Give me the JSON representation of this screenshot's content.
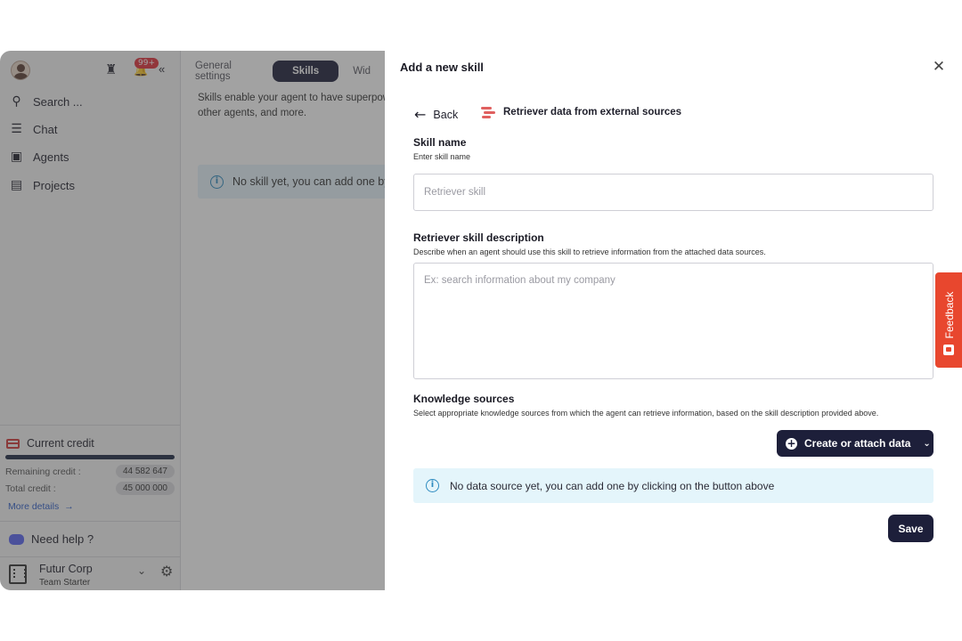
{
  "sidebar": {
    "notification_badge": "99+",
    "nav": [
      {
        "label": "Search ...",
        "icon": "search-icon"
      },
      {
        "label": "Chat",
        "icon": "chat-icon"
      },
      {
        "label": "Agents",
        "icon": "robot-icon"
      },
      {
        "label": "Projects",
        "icon": "clipboard-icon"
      }
    ],
    "credit": {
      "title": "Current credit",
      "remaining_label": "Remaining credit :",
      "remaining_value": "44 582 647",
      "total_label": "Total credit :",
      "total_value": "45 000 000",
      "more_details": "More details"
    },
    "help_label": "Need help ?",
    "org": {
      "name": "Futur Corp",
      "plan": "Team Starter"
    }
  },
  "main": {
    "tabs": [
      {
        "label": "General settings",
        "active": false
      },
      {
        "label": "Skills",
        "active": true
      },
      {
        "label": "Wid",
        "active": false
      }
    ],
    "description": "Skills enable your agent to have superpowers... other agents, and more.",
    "description_line1": "Skills enable your agent to have superpow",
    "description_line2": "other agents, and more.",
    "info_text": "No skill yet, you can add one by"
  },
  "panel": {
    "title": "Add a new skill",
    "back_label": "Back",
    "skill_type": "Retriever data from external sources",
    "skill_name": {
      "label": "Skill name",
      "hint": "Enter skill name",
      "placeholder": "Retriever skill",
      "value": ""
    },
    "description": {
      "label": "Retriever skill description",
      "hint": "Describe when an agent should use this skill to retrieve information from the attached data sources.",
      "placeholder": "Ex: search information about my company",
      "value": ""
    },
    "knowledge": {
      "label": "Knowledge sources",
      "hint": "Select appropriate knowledge sources from which the agent can retrieve information, based on the skill description provided above.",
      "create_button": "Create or attach data",
      "empty_text": "No data source yet, you can add one by clicking on the button above"
    },
    "save_label": "Save"
  },
  "feedback_label": "Feedback",
  "colors": {
    "primary_dark": "#1d1f3a",
    "feedback": "#e8472e",
    "info_bg": "#e4f5fb",
    "retriever_accent": "#e0605f"
  }
}
